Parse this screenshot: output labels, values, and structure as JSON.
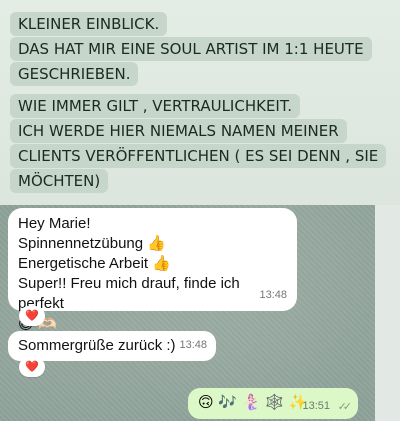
{
  "caption_top": {
    "lines": [
      "KLEINER EINBLICK.",
      "DAS HAT MIR EINE SOUL ARTIST IM 1:1  HEUTE",
      "GESCHRIEBEN."
    ]
  },
  "caption_bottom": {
    "lines": [
      "WIE IMMER GILT , VERTRAULICHKEIT.",
      "ICH WERDE HIER NIEMALS NAMEN MEINER",
      "CLIENTS VERÖFFENTLICHEN ( ES SEI DENN , SIE",
      "MÖCHTEN)"
    ]
  },
  "chat": {
    "incoming_1": {
      "lines": [
        "Hey Marie!",
        "Spinnennetzübung 👍",
        "Energetische Arbeit 👍",
        "Super!! Freu mich drauf, finde ich perfekt",
        "😃 🫶🏻"
      ],
      "time": "13:48",
      "reaction": "❤️"
    },
    "incoming_2": {
      "text": "Sommergrüße zurück :)",
      "time": "13:48",
      "reaction": "❤️"
    },
    "outgoing_1": {
      "emojis": "🙃 🎶 🧜🏻‍♀️ 🕸️ ✨",
      "time": "13:51",
      "status_icon": "double-check-icon"
    }
  },
  "colors": {
    "caption_highlight": "#c7d6ca",
    "incoming_bubble": "#ffffff",
    "outgoing_bubble": "#dcf8c6",
    "chat_wallpaper": "#8fa39a"
  }
}
